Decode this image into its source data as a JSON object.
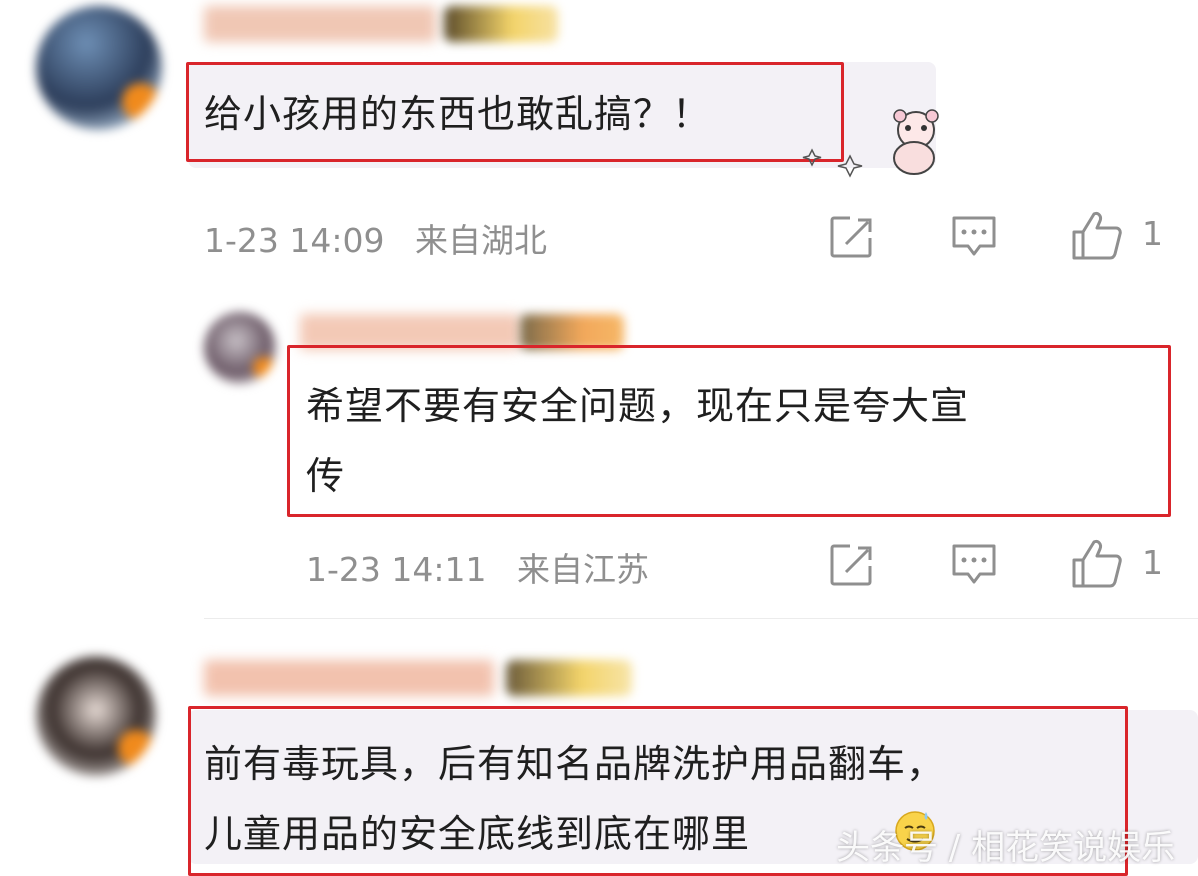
{
  "comments": [
    {
      "text": "给小孩用的东西也敢乱搞？！",
      "time": "1-23 14:09",
      "location": "来自湖北",
      "likes": "1"
    },
    {
      "text_line1": "希望不要有安全问题，现在只是夸大宣",
      "text_line2": "传",
      "time": "1-23 14:11",
      "location": "来自江苏",
      "likes": "1"
    },
    {
      "text_line1": "前有毒玩具，后有知名品牌洗护用品翻车，",
      "text_line2": "儿童用品的安全底线到底在哪里"
    }
  ],
  "watermark": "头条号 / 相花笑说娱乐",
  "icons": {
    "share": "share-edit-icon",
    "reply": "comment-bubble-icon",
    "like": "thumbs-up-icon"
  },
  "colors": {
    "highlight": "#d9252b",
    "meta_text": "#8f8f8f",
    "bubble_bg": "#f3f1f6",
    "vip_badge": "#f08a1c"
  }
}
